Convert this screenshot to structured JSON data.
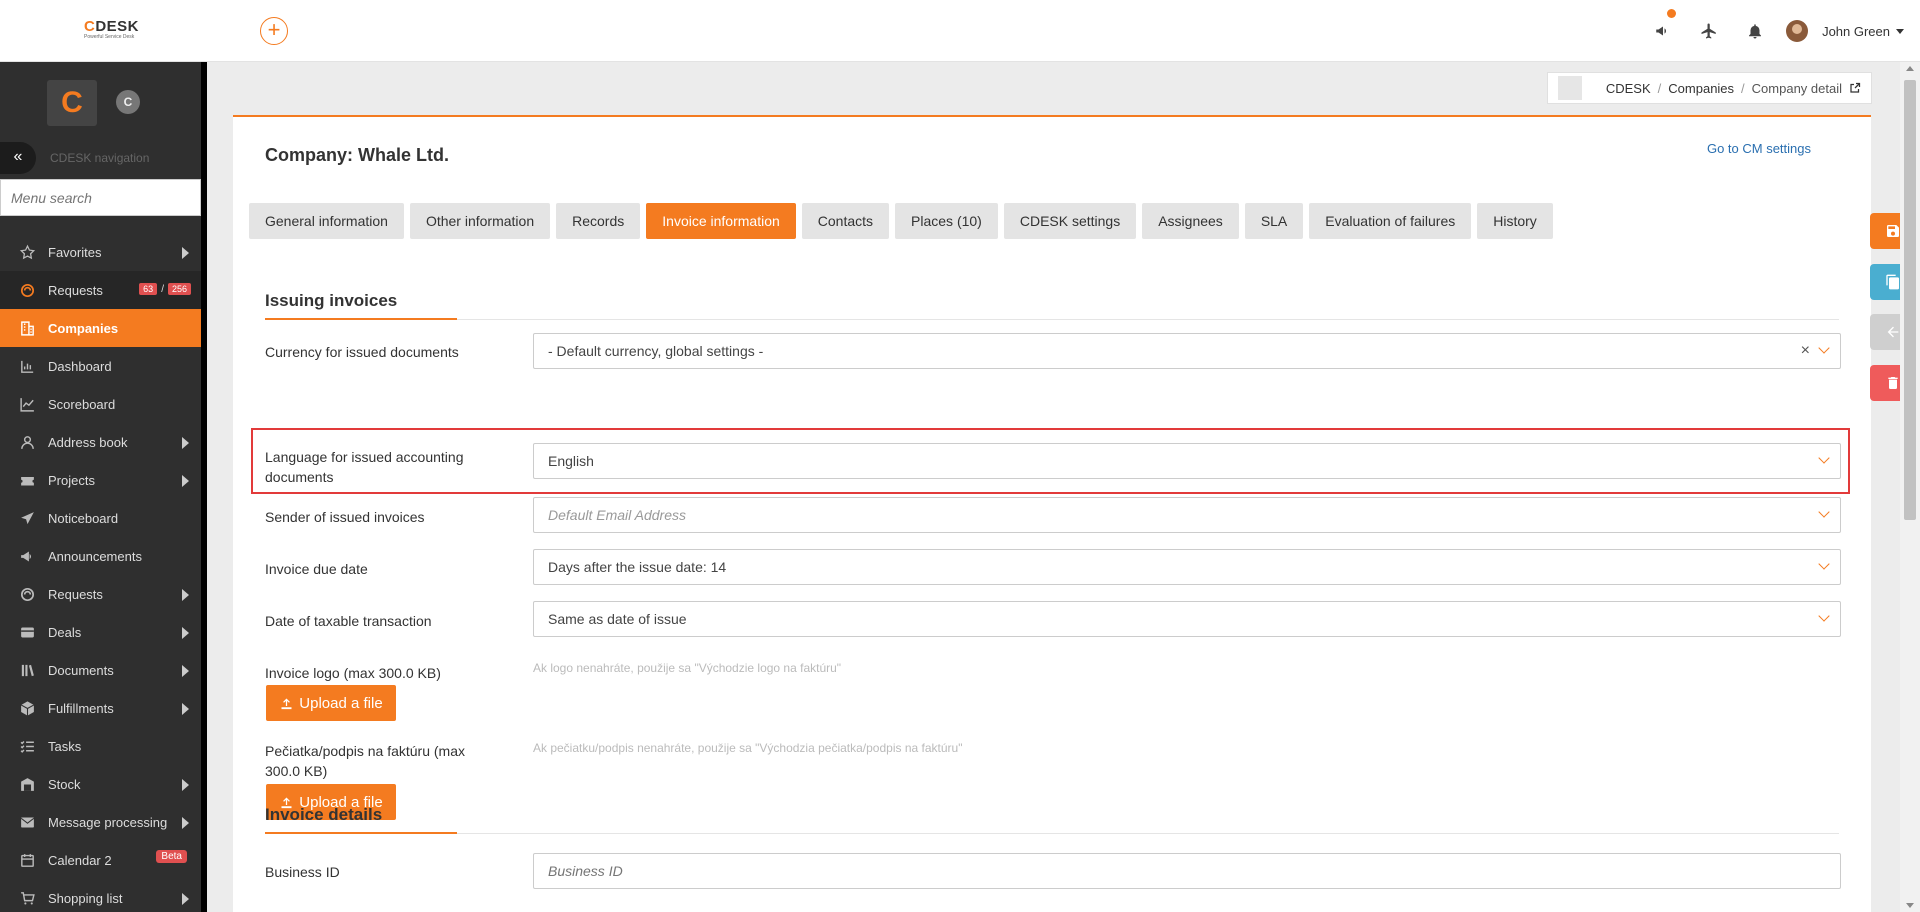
{
  "header": {
    "logo_text_c": "C",
    "logo_text_rest": "DESK",
    "logo_tagline": "Powerful Service Desk",
    "plus_label": "+",
    "user_name": "John Green",
    "icons": [
      "megaphone-icon",
      "airplane-icon",
      "bell-icon"
    ]
  },
  "sidebar": {
    "brand_letter": "C",
    "circle_letter": "C",
    "collapse_label": "«",
    "nav_label": "CDESK navigation",
    "search_placeholder": "Menu search",
    "items": [
      {
        "label": "Favorites",
        "icon": "star-icon",
        "arrow": true
      },
      {
        "label": "Requests",
        "icon": "request-icon",
        "badge1": "63",
        "badge_sep": "/",
        "badge2": "256"
      },
      {
        "label": "Companies",
        "icon": "building-icon",
        "active": true
      },
      {
        "label": "Dashboard",
        "icon": "dashboard-icon"
      },
      {
        "label": "Scoreboard",
        "icon": "chart-icon"
      },
      {
        "label": "Address book",
        "icon": "person-icon",
        "arrow": true
      },
      {
        "label": "Projects",
        "icon": "ticket-icon",
        "arrow": true
      },
      {
        "label": "Noticeboard",
        "icon": "send-icon"
      },
      {
        "label": "Announcements",
        "icon": "megaphone-icon"
      },
      {
        "label": "Requests",
        "icon": "request-icon",
        "arrow": true
      },
      {
        "label": "Deals",
        "icon": "card-icon",
        "arrow": true
      },
      {
        "label": "Documents",
        "icon": "books-icon",
        "arrow": true
      },
      {
        "label": "Fulfillments",
        "icon": "box-icon",
        "arrow": true
      },
      {
        "label": "Tasks",
        "icon": "tasks-icon"
      },
      {
        "label": "Stock",
        "icon": "stock-icon",
        "arrow": true
      },
      {
        "label": "Message processing",
        "icon": "envelope-icon",
        "arrow": true
      },
      {
        "label": "Calendar 2",
        "icon": "calendar-icon",
        "beta": "Beta"
      },
      {
        "label": "Shopping list",
        "icon": "cart-icon",
        "arrow": true
      }
    ]
  },
  "breadcrumb": {
    "items": [
      "CDESK",
      "Companies"
    ],
    "separator": "/",
    "current": "Company detail"
  },
  "page": {
    "title": "Company: Whale Ltd.",
    "cm_link": "Go to CM settings",
    "tabs": [
      {
        "label": "General information"
      },
      {
        "label": "Other information"
      },
      {
        "label": "Records"
      },
      {
        "label": "Invoice information",
        "active": true
      },
      {
        "label": "Contacts"
      },
      {
        "label": "Places (10)"
      },
      {
        "label": "CDESK settings"
      },
      {
        "label": "Assignees"
      },
      {
        "label": "SLA"
      },
      {
        "label": "Evaluation of failures"
      },
      {
        "label": "History"
      }
    ]
  },
  "issuing": {
    "title": "Issuing invoices",
    "currency_label": "Currency for issued documents",
    "currency_value": "- Default currency, global settings -",
    "clear_label": "×",
    "language_label": "Language for issued accounting documents",
    "language_value": "English",
    "sender_label": "Sender of issued invoices",
    "sender_placeholder": "Default Email Address",
    "due_label": "Invoice due date",
    "due_value": "Days after the issue date: 14",
    "taxable_label": "Date of taxable transaction",
    "taxable_value": "Same as date of issue",
    "logo_label": "Invoice logo (max 300.0 KB)",
    "logo_hint": "Ak logo nenahráte, použije sa \"Východzie logo na faktúru\"",
    "upload_label": "Upload a file",
    "stamp_label": "Pečiatka/podpis na faktúru (max 300.0 KB)",
    "stamp_hint": "Ak pečiatku/podpis nenahráte, použije sa \"Východzia pečiatka/podpis na faktúru\""
  },
  "details": {
    "title": "Invoice details",
    "business_id_label": "Business ID",
    "business_id_placeholder": "Business ID"
  },
  "colors": {
    "accent": "#f47b20",
    "sidebar": "#2f2f2f",
    "highlight": "#e23a3a",
    "fab_copy": "#4aaed0",
    "fab_back": "#cfcfcf",
    "fab_delete": "#ef5b5b"
  }
}
